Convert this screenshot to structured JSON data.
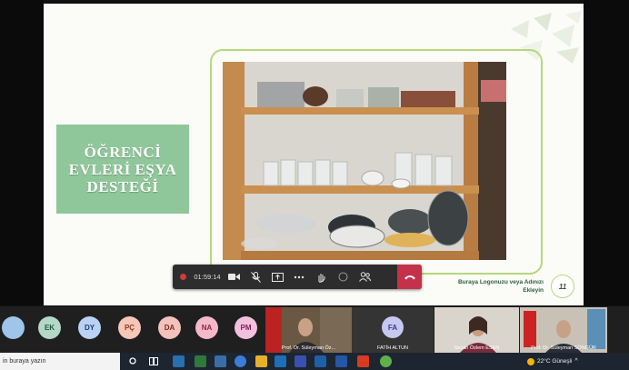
{
  "slide": {
    "title_line1": "ÖĞRENCİ",
    "title_line2": "EVLERİ EŞYA",
    "title_line3": "DESTEĞİ",
    "logo_line1": "Buraya Logonuzu veya Adınızı",
    "logo_line2": "Ekleyin",
    "page_number": "11"
  },
  "toolbar": {
    "timer": "01:59:14"
  },
  "participants": {
    "avatars": [
      {
        "initials": "",
        "bg": "#9fc5e8",
        "fg": "#1e3a5f"
      },
      {
        "initials": "EK",
        "bg": "#b4d7c8",
        "fg": "#1d5b3f"
      },
      {
        "initials": "DY",
        "bg": "#b9d1f3",
        "fg": "#1c3f77"
      },
      {
        "initials": "PÇ",
        "bg": "#f6c6b8",
        "fg": "#8a3a1e"
      },
      {
        "initials": "DA",
        "bg": "#f3c2bd",
        "fg": "#7d2a20"
      },
      {
        "initials": "NA",
        "bg": "#f4b9c9",
        "fg": "#8c2446"
      },
      {
        "initials": "PM",
        "bg": "#f1c0dc",
        "fg": "#7e1f5a"
      }
    ],
    "tiles": [
      {
        "name": "Prof. Dr. Süleyman Öz...",
        "initials": ""
      },
      {
        "name": "FATİH ALTUN",
        "initials": "FA"
      },
      {
        "name": "Sezan Özlem ESEN",
        "initials": ""
      },
      {
        "name": "Prof. Dr. Süleyman SÖNGÜR",
        "initials": ""
      }
    ]
  },
  "taskbar": {
    "search_placeholder": "in buraya yazın",
    "weather": "22°C Güneşli"
  }
}
